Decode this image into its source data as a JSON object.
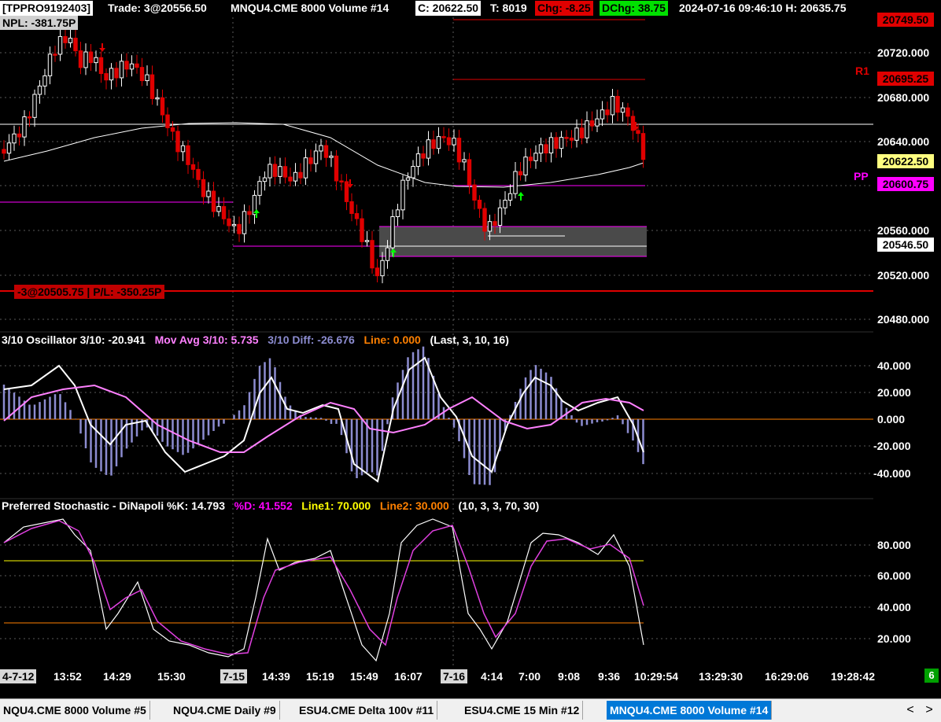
{
  "header": {
    "account": "[TPPRO9192403]",
    "trade": "Trade: 3@20556.50",
    "symbol": "MNQU4.CME  8000 Volume #14",
    "close": "C: 20622.50",
    "ticks": "T: 8019",
    "chg": "Chg: -8.25",
    "dchg": "DChg: 38.75",
    "datetime_high": "2024-07-16 09:46:10  H: 20635.75",
    "npl": "NPL: -381.75P"
  },
  "price_axis": {
    "labels": [
      "20720.000",
      "20680.000",
      "20640.000",
      "20600.000",
      "20560.000",
      "20520.000",
      "20480.000"
    ],
    "tag_top": "20749.50",
    "tag_r1": "20695.25",
    "tag_last": "20622.50",
    "tag_pp": "20600.75",
    "tag_low": "20546.50",
    "r1_label": "R1",
    "pp_label": "PP"
  },
  "position": {
    "text": "-3@20505.75 | P/L: -350.25P"
  },
  "oscillator": {
    "t1": "3/10 Oscillator  3/10: -20.941",
    "t2": "Mov Avg 3/10: 5.735",
    "t3": "3/10 Diff: -26.676",
    "t4": "Line: 0.000",
    "t5": "(Last, 3, 10, 16)",
    "labels": [
      "40.000",
      "20.000",
      "0.000",
      "-20.000",
      "-40.000"
    ]
  },
  "stochastic": {
    "t1": "Preferred Stochastic - DiNapoli  %K: 14.793",
    "t2": "%D: 41.552",
    "t3": "Line1: 70.000",
    "t4": "Line2: 30.000",
    "t5": "(10, 3, 3, 70, 30)",
    "labels": [
      "80.000",
      "60.000",
      "40.000",
      "20.000"
    ]
  },
  "time_axis": {
    "labels": [
      "4-7-12",
      "13:52",
      "14:29",
      "15:30",
      "7-15",
      "14:39",
      "15:19",
      "15:49",
      "16:07",
      "7-16",
      "4:14",
      "7:00",
      "9:08",
      "9:36",
      "10:29:54",
      "13:29:30",
      "16:29:06",
      "19:28:42"
    ],
    "badge": "6"
  },
  "tabs": [
    "NQU4.CME  8000 Volume #5",
    "NQU4.CME  Daily #9",
    "ESU4.CME  Delta 100v #11",
    "ESU4.CME  15 Min  #12",
    "MNQU4.CME  8000 Volume #14"
  ],
  "nav": {
    "prev": "<",
    "next": ">"
  },
  "colors": {
    "bull": "#ffffff",
    "bear": "#e00000",
    "sma": "#ffffff",
    "pivot": "#ff00ff",
    "osc_bar": "#8c8cd0",
    "osc_avg": "#ff80ff",
    "zero_line": "#ff8000",
    "line1": "#ffff00",
    "line2": "#ff8000",
    "k_line": "#ffffff",
    "d_line": "#e040e0"
  }
}
